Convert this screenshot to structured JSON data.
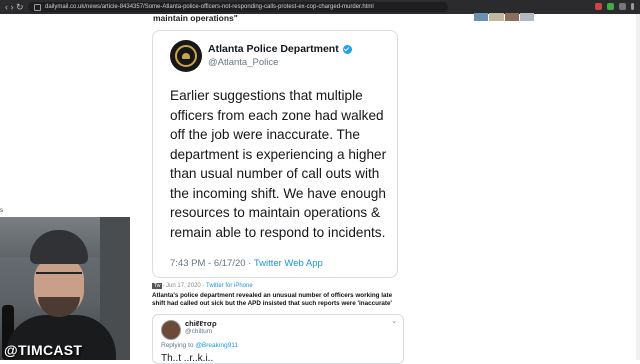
{
  "browser": {
    "url": "dailymail.co.uk/news/article-8434357/Some-Atlanta-police-officers-not-responding-calls-protest-ex-cop-charged-murder.html",
    "nav_glyph": "‹ › ↻"
  },
  "article": {
    "quote_tail": "maintain operations\"",
    "left_fragment": "s",
    "caption": "Atlanta's police department revealed an unusual number of officers working late shift had called out sick but the APD insisted that such reports were 'inaccurate'"
  },
  "tweet": {
    "display_name": "Atlanta Police Department",
    "handle": "@Atlanta_Police",
    "body": "Earlier suggestions that multiple officers from each zone had walked off the job were inaccurate. The department is experiencing a higher than usual number of call outs with the incoming shift. We have enough resources to maintain operations & remain able to respond to incidents.",
    "time": "7:43 PM - 6/17/20",
    "separator": " · ",
    "source": "Twitter Web App"
  },
  "card_meta": {
    "badge": "Tw",
    "date": "- Jun 17, 2020 · ",
    "link": "Twitter for iPhone"
  },
  "tweet2": {
    "display_name": "chiℓℓтσρ",
    "handle": "@chiltum",
    "reply_prefix": "Replying to ",
    "reply_mention": "@Breaking911",
    "body_cut": "Th..t ..r..k.i.."
  },
  "overlay": {
    "watermark": "@TIMCAST"
  },
  "colors": {
    "twitter_blue": "#1da1f2",
    "link_blue": "#1b95e0",
    "browser_dark": "#2b2b2e"
  }
}
